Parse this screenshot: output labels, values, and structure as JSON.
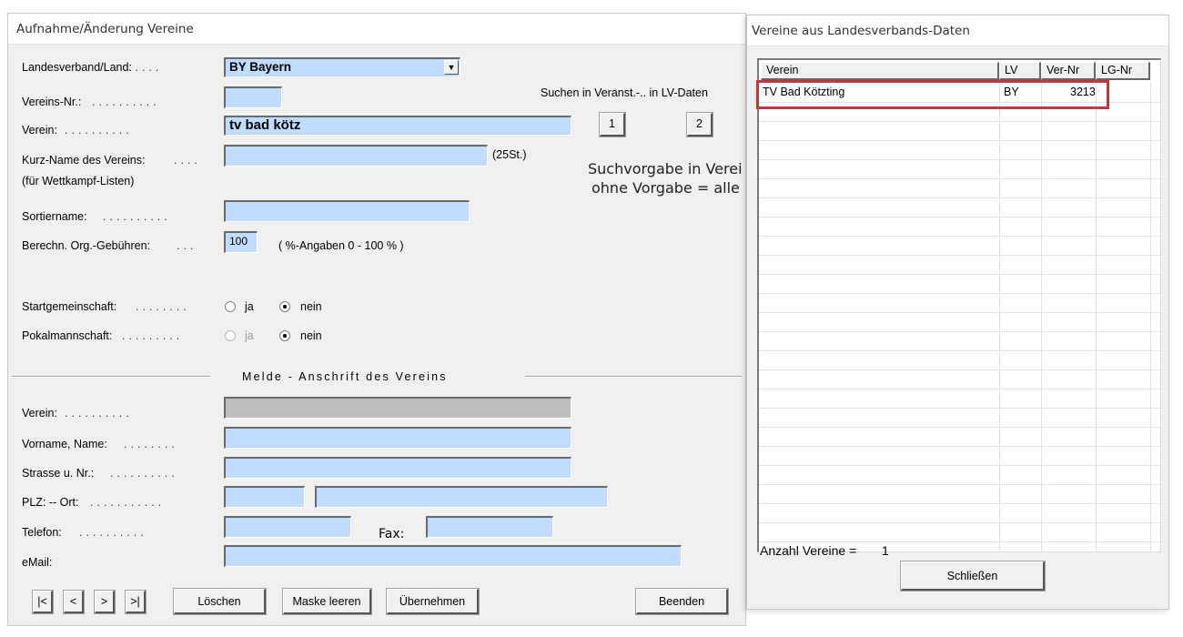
{
  "main_window": {
    "title": "Aufnahme/Änderung Vereine",
    "landesverband": {
      "label": "Landesverband/Land:",
      "value": "BY Bayern"
    },
    "vereins_nr": {
      "label": "Vereins-Nr.:",
      "value": ""
    },
    "search_label": "Suchen in Veranst.-.. in LV-Daten",
    "search_btn1": "1",
    "search_btn2": "2",
    "verein": {
      "label": "Verein:",
      "value": "tv bad kötz"
    },
    "kurzname": {
      "label": "Kurz-Name des Vereins:",
      "sublabel": "(für Wettkampf-Listen)",
      "value": "",
      "hint": "(25St.)"
    },
    "hint_line1": "Suchvorgabe in Verei",
    "hint_line2": "ohne Vorgabe  =  alle",
    "sortiername": {
      "label": "Sortiername:",
      "value": ""
    },
    "gebuehren": {
      "label": "Berechn. Org.-Gebühren:",
      "value": "100",
      "hint": "( %-Angaben    0 - 100 % )"
    },
    "startgemeinschaft": {
      "label": "Startgemeinschaft:",
      "opt_ja": "ja",
      "opt_nein": "nein",
      "selected": "nein"
    },
    "pokalmannschaft": {
      "label": "Pokalmannschaft:",
      "opt_ja": "ja",
      "opt_nein": "nein",
      "selected": "nein"
    },
    "section_title": "Melde - Anschrift des Vereins",
    "addr_verein": {
      "label": "Verein:",
      "value": ""
    },
    "addr_name": {
      "label": "Vorname, Name:",
      "value": ""
    },
    "addr_strasse": {
      "label": "Strasse u. Nr.:",
      "value": ""
    },
    "addr_plz": {
      "label": "PLZ: -- Ort:",
      "plz": "",
      "ort": ""
    },
    "addr_telefon": {
      "label": "Telefon:",
      "value": ""
    },
    "addr_fax": {
      "label": "Fax:",
      "value": ""
    },
    "addr_email": {
      "label": "eMail:",
      "value": ""
    },
    "nav": {
      "first": "|<",
      "prev": "<",
      "next": ">",
      "last": ">|"
    },
    "buttons": {
      "loeschen": "Löschen",
      "maske_leeren": "Maske leeren",
      "uebernehmen": "Übernehmen",
      "beenden": "Beenden"
    }
  },
  "dialog": {
    "title": "Vereine aus Landesverbands-Daten",
    "columns": [
      "Verein",
      "LV",
      "Ver-Nr",
      "LG-Nr"
    ],
    "rows": [
      {
        "verein": "TV Bad Kötzting",
        "lv": "BY",
        "ver_nr": "3213",
        "lg_nr": ""
      }
    ],
    "count_label": "Anzahl Vereine =",
    "count_value": "1",
    "close_label": "Schließen"
  },
  "colors": {
    "field_bg": "#c0dcff",
    "highlight": "#c1393f",
    "window_bg": "#f0f0f0"
  }
}
